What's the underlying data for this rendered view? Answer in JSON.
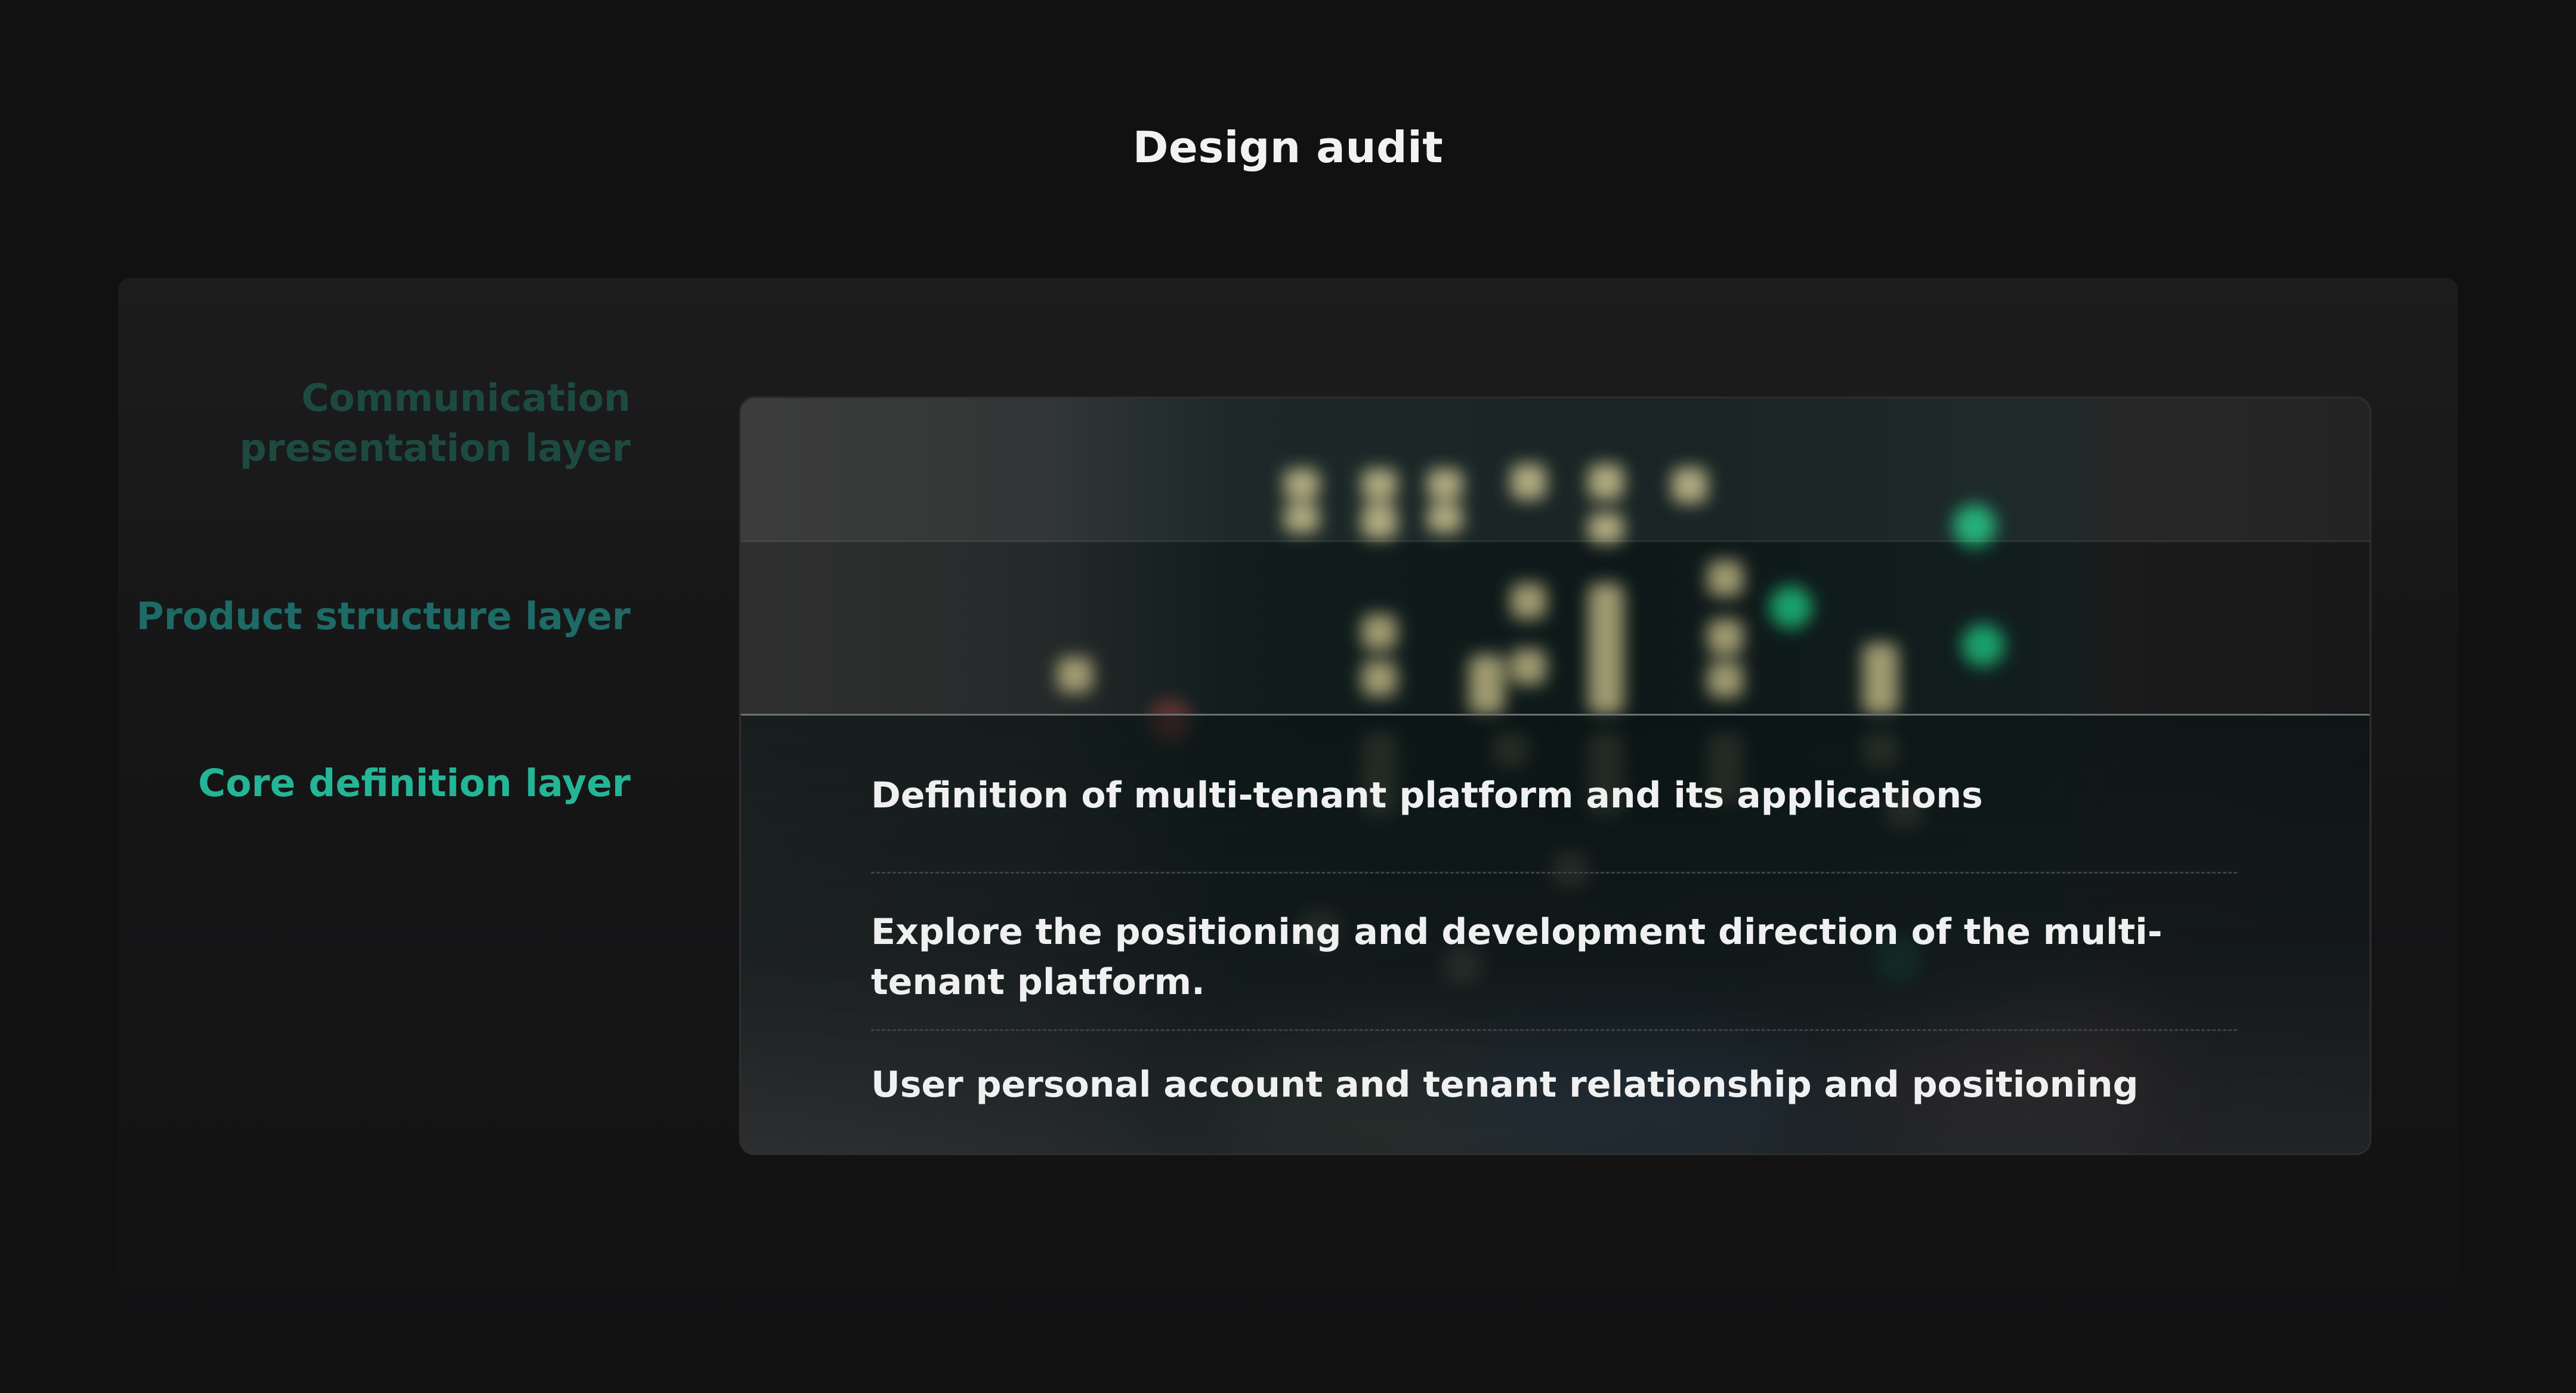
{
  "page": {
    "title": "Design audit"
  },
  "layers": {
    "communication": "Communication\npresentation layer",
    "communication_line1": "Communication",
    "communication_line2": "presentation layer",
    "product": "Product structure layer",
    "core": "Core definition layer"
  },
  "core_items": [
    "Definition of multi-tenant platform and its applications",
    "Explore the positioning and development direction of the multi-tenant platform.",
    "User personal account and tenant relationship and positioning"
  ],
  "colors": {
    "background": "#111111",
    "panel": "#1d1d1e",
    "label_faded": "#1d4a40",
    "label_mid": "#1d6a66",
    "label_active": "#24b596",
    "text": "#f0f0f0"
  }
}
